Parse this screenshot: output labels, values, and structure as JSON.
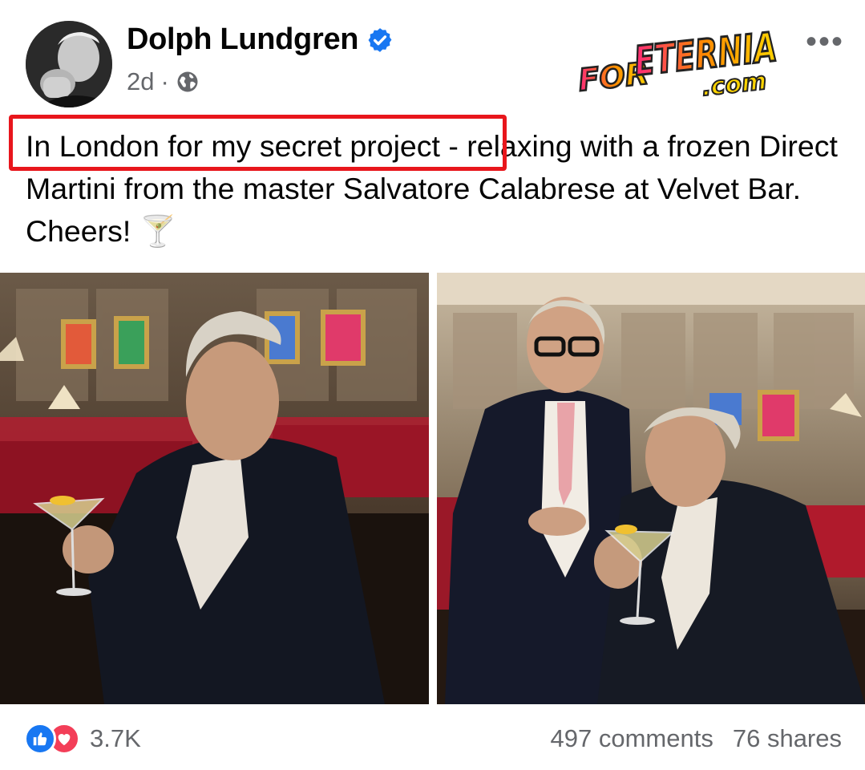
{
  "post": {
    "author": "Dolph Lundgren",
    "time": "2d",
    "separator": "·",
    "text": "In London for my secret project - relaxing with a frozen Direct Martini from the master Salvatore Calabrese at Velvet Bar. Cheers! 🍸",
    "more_label": "•••"
  },
  "watermark": {
    "line1": "FOR ETERNIA",
    "line2": ".com"
  },
  "stats": {
    "reactions": "3.7K",
    "comments": "497 comments",
    "shares": "76 shares"
  },
  "icons": {
    "verified": "verified-badge-icon",
    "privacy": "globe-icon",
    "like": "like-icon",
    "love": "love-icon",
    "more": "more-icon"
  },
  "colors": {
    "fb_blue": "#1877f2",
    "love_red": "#f33e58",
    "secondary_text": "#65676b",
    "highlight_red": "#e8161c"
  }
}
